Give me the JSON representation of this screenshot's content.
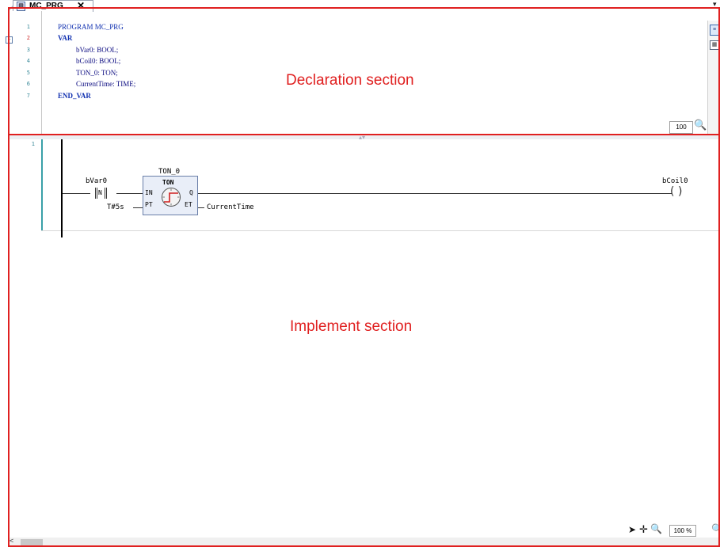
{
  "editor": {
    "tab_title": "MC_PRG",
    "tab_close": "✕",
    "scroll_arrow": "▾"
  },
  "declaration": {
    "lines": [
      {
        "num": "1",
        "text": "PROGRAM MC_PRG"
      },
      {
        "num": "2",
        "text": "VAR"
      },
      {
        "num": "3",
        "text": "bVar0: BOOL;"
      },
      {
        "num": "4",
        "text": "bCoil0: BOOL;"
      },
      {
        "num": "5",
        "text": "TON_0: TON;"
      },
      {
        "num": "6",
        "text": "CurrentTime: TIME;"
      },
      {
        "num": "7",
        "text": "END_VAR"
      }
    ],
    "label": "Declaration section",
    "zoom": "100"
  },
  "implementation": {
    "rung_number": "1",
    "contact_var": "bVar0",
    "contact_symbol": "N",
    "fb_instance": "TON_0",
    "fb_type": "TON",
    "fb_in": "IN",
    "fb_pt": "PT",
    "fb_q": "Q",
    "fb_et": "ET",
    "pt_value": "T#5s",
    "et_var": "CurrentTime",
    "coil_var": "bCoil0",
    "label": "Implement section",
    "zoom": "100 %",
    "scroll_left": "<"
  },
  "colors": {
    "frame": "#e02020",
    "label": "#e02020"
  }
}
